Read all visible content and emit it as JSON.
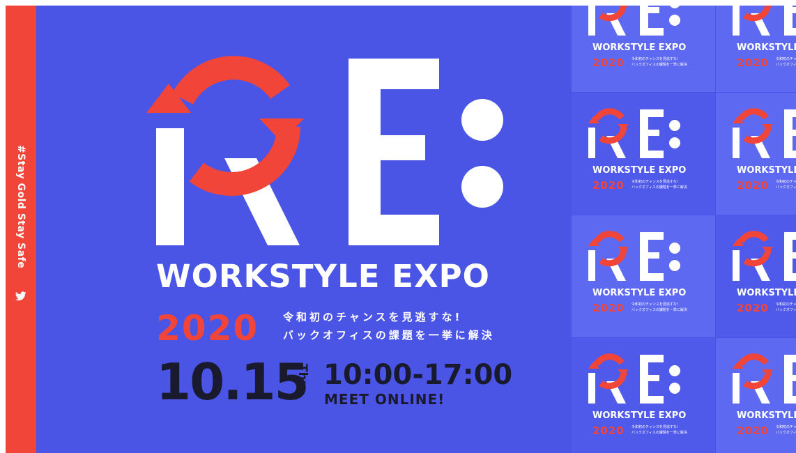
{
  "sidebar": {
    "hashtag": "#Stay Gold Stay Safe",
    "twitter_icon": "twitter-icon"
  },
  "hero": {
    "logo_text": "RE:",
    "title": "WORKSTYLE EXPO",
    "year": "2020",
    "tagline_line1": "令和初のチャンスを見逃すな!",
    "tagline_line2": "バックオフィスの課題を一挙に解決",
    "date": "10.15",
    "weekday": "Thu",
    "time": "10:00-17:00",
    "venue": "MEET ONLINE!"
  },
  "tiles": {
    "title": "WORKSTYLE EXPO",
    "year": "2020",
    "tag1": "令和初のチャンスを見逃すな!",
    "tag2": "バックオフィスの課題を一挙に解決"
  },
  "colors": {
    "background": "#4a55e6",
    "tile_light": "#5d69f0",
    "tile_dark": "#4f5aea",
    "accent_red": "#f1453a",
    "ink": "#1a1a2e"
  }
}
